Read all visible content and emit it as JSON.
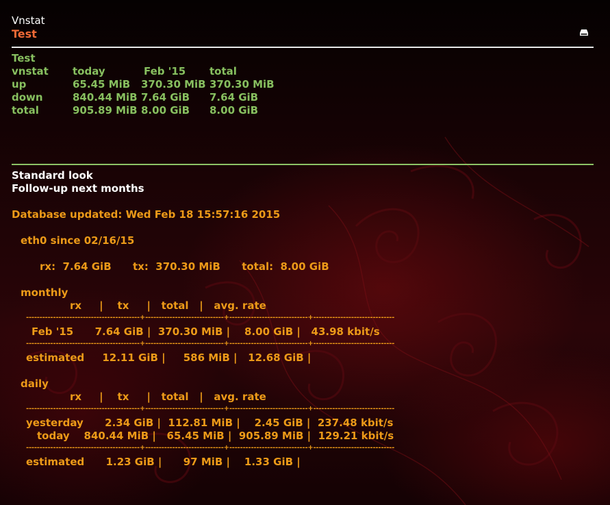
{
  "header": {
    "title": "Vnstat",
    "subtitle": "Test"
  },
  "summary": {
    "name": "Test",
    "rows": [
      [
        "vnstat",
        "today",
        "Feb '15",
        "total"
      ],
      [
        "up",
        "65.45 MiB",
        "370.30 MiB",
        "370.30 MiB"
      ],
      [
        "down",
        "840.44 MiB",
        "7.64 GiB",
        "7.64 GiB"
      ],
      [
        "total",
        "905.89 MiB",
        "8.00 GiB",
        "8.00 GiB"
      ]
    ]
  },
  "look": {
    "title": "Standard look",
    "subtitle": "Follow-up next months"
  },
  "output": {
    "updated": "Database updated: Wed Feb 18 15:57:16 2015",
    "since": "eth0 since 02/16/15",
    "totals": "rx:  7.64 GiB      tx:  370.30 MiB      total:  8.00 GiB",
    "monthly_label": "monthly",
    "monthly_header": "rx     |    tx     |   total   |   avg. rate",
    "separator": "------------------------------------------+-----------------------------+-----------------------------+------------------------------",
    "monthly_row": "Feb '15      7.64 GiB |  370.30 MiB |    8.00 GiB |   43.98 kbit/s",
    "monthly_estimated": "estimated     12.11 GiB |     586 MiB |   12.68 GiB |",
    "daily_label": "daily",
    "daily_header": "rx     |    tx     |   total   |   avg. rate",
    "daily_yesterday": "yesterday      2.34 GiB |  112.81 MiB |    2.45 GiB |  237.48 kbit/s",
    "daily_today": "today    840.44 MiB |   65.45 MiB |  905.89 MiB |  129.21 kbit/s",
    "daily_estimated": "estimated      1.23 GiB |      97 MiB |    1.33 GiB |"
  },
  "colors": {
    "accent_orange": "#ec9a18",
    "accent_green": "#87bf5f",
    "subtitle_red": "#f06a36"
  },
  "icons": {
    "drive": "drive-icon"
  }
}
